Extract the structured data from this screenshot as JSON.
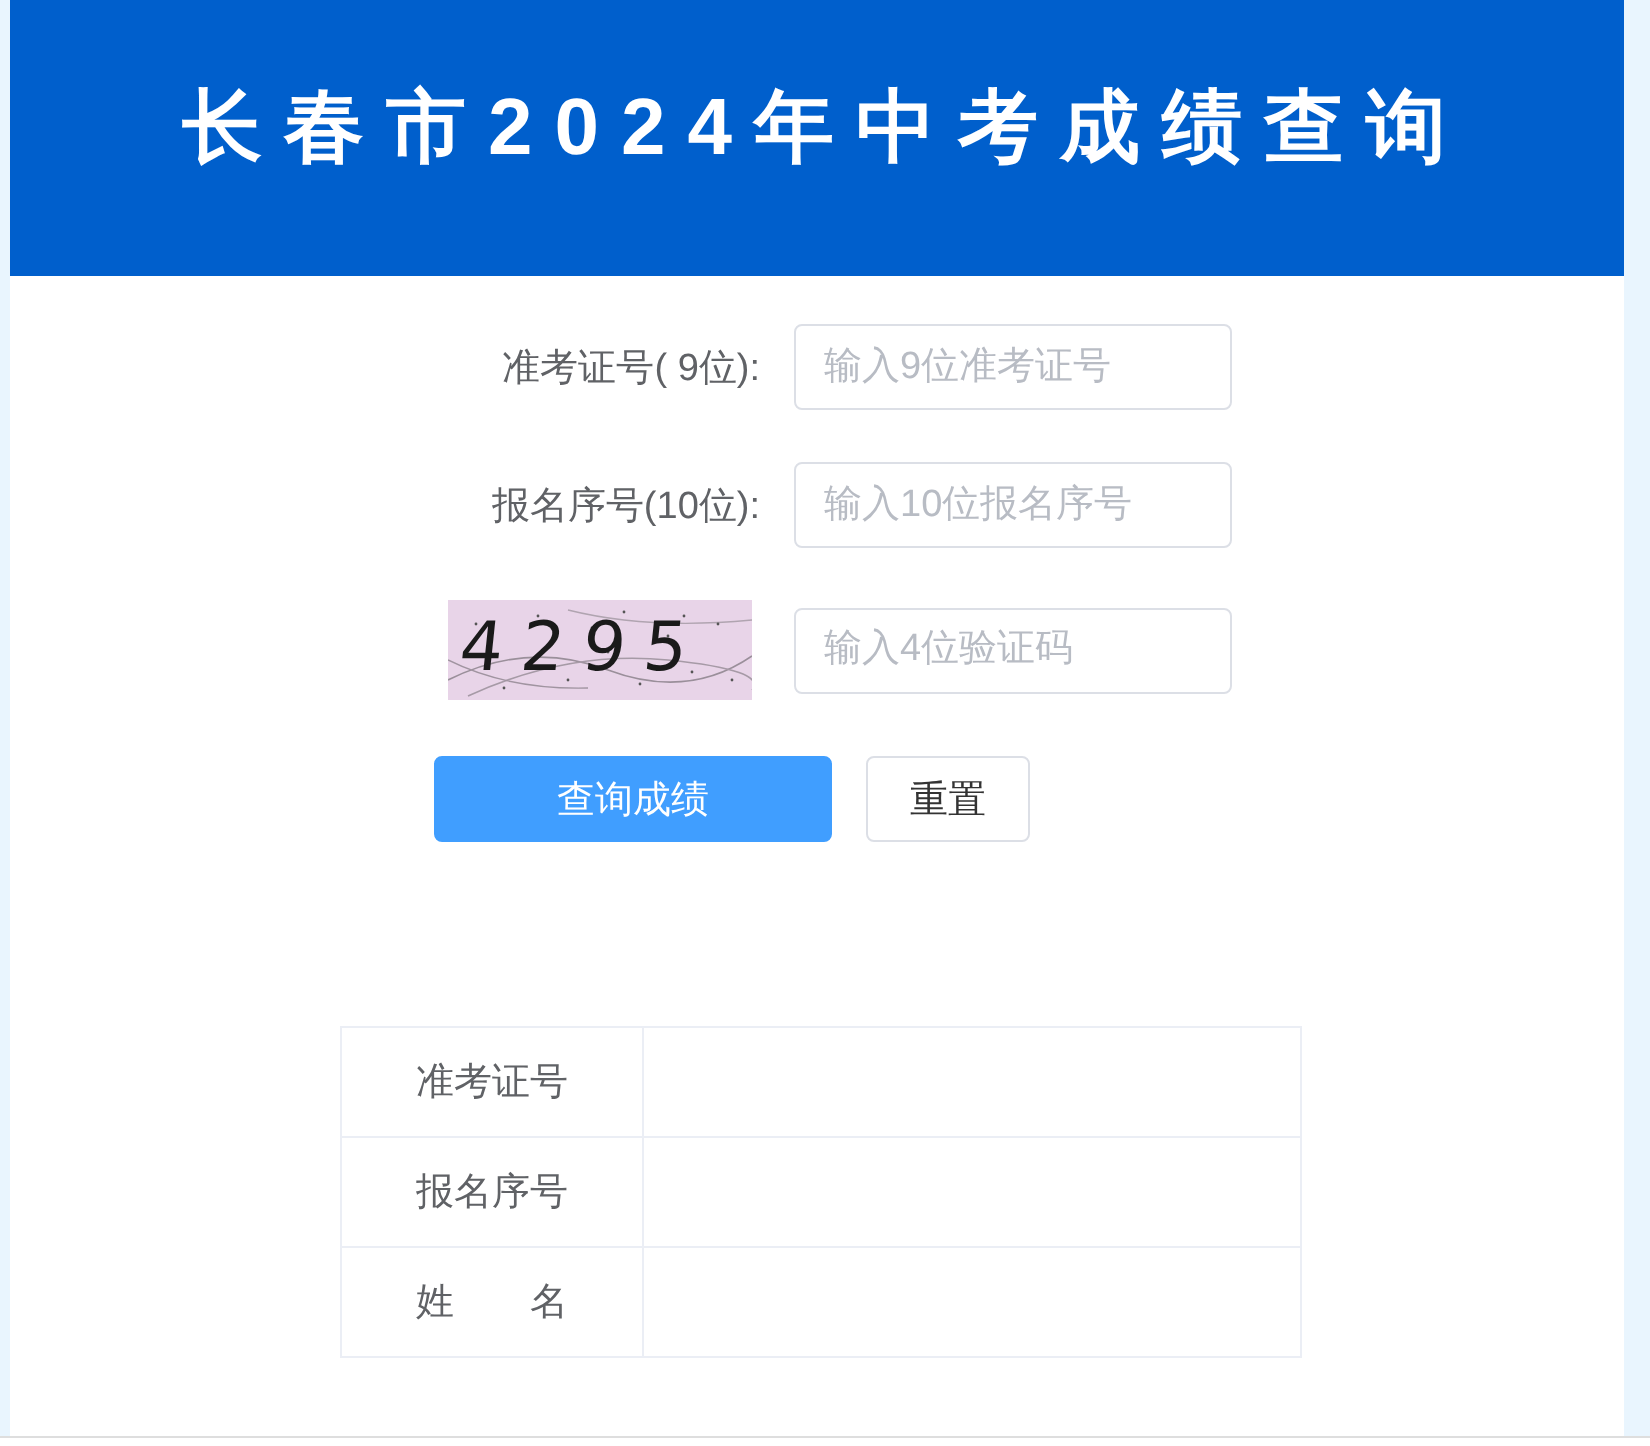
{
  "header": {
    "title": "长春市2024年中考成绩查询"
  },
  "form": {
    "fields": [
      {
        "kind": "text",
        "label": "准考证号( 9位):",
        "placeholder": "输入9位准考证号"
      },
      {
        "kind": "text",
        "label": "报名序号(10位):",
        "placeholder": "输入10位报名序号"
      },
      {
        "kind": "captcha",
        "captcha_code": "4295",
        "placeholder": "输入4位验证码"
      }
    ],
    "buttons": [
      {
        "kind": "primary",
        "label": "查询成绩"
      },
      {
        "kind": "default",
        "label": "重置"
      }
    ]
  },
  "result_table": {
    "rows": [
      {
        "label": "准考证号"
      },
      {
        "label": "报名序号"
      },
      {
        "label": "姓　　名"
      }
    ]
  }
}
